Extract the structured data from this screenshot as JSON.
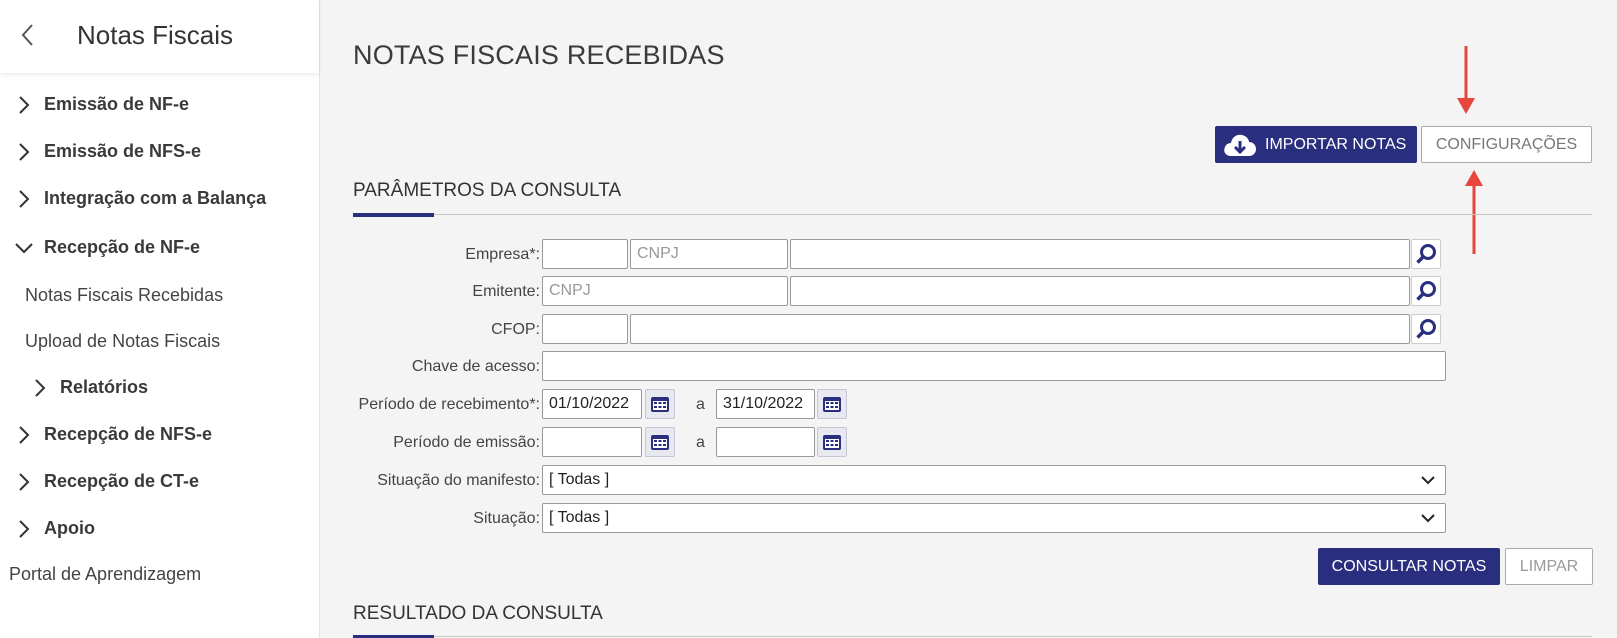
{
  "sidebar": {
    "title": "Notas Fiscais",
    "items": [
      {
        "label": "Emissão de NF-e"
      },
      {
        "label": "Emissão de NFS-e"
      },
      {
        "label": "Integração com a Balança"
      },
      {
        "label": "Recepção de NF-e"
      },
      {
        "label": "Notas Fiscais Recebidas"
      },
      {
        "label": "Upload de Notas Fiscais"
      },
      {
        "label": "Relatórios"
      },
      {
        "label": "Recepção de NFS-e"
      },
      {
        "label": "Recepção de CT-e"
      },
      {
        "label": "Apoio"
      },
      {
        "label": "Portal de Aprendizagem"
      }
    ]
  },
  "main": {
    "title": "NOTAS FISCAIS RECEBIDAS",
    "import_label": "IMPORTAR NOTAS",
    "config_label": "CONFIGURAÇÕES",
    "params_title": "PARÂMETROS DA CONSULTA",
    "result_title": "RESULTADO DA CONSULTA",
    "consult_label": "CONSULTAR NOTAS",
    "clear_label": "LIMPAR"
  },
  "form": {
    "empresa_label": "Empresa*:",
    "emitente_label": "Emitente:",
    "cfop_label": "CFOP:",
    "chave_label": "Chave de acesso:",
    "periodo_receb_label": "Período de recebimento*:",
    "periodo_emissao_label": "Período de emissão:",
    "situacao_manifesto_label": "Situação do manifesto:",
    "situacao_label": "Situação:",
    "cnpj_placeholder": "CNPJ",
    "receb_from": "01/10/2022",
    "receb_to": "31/10/2022",
    "range_sep": "a",
    "situacao_manifesto_value": "[ Todas ]",
    "situacao_value": "[ Todas ]"
  },
  "colors": {
    "primary": "#2a2e7e",
    "annotation_arrow": "#e8453c"
  }
}
